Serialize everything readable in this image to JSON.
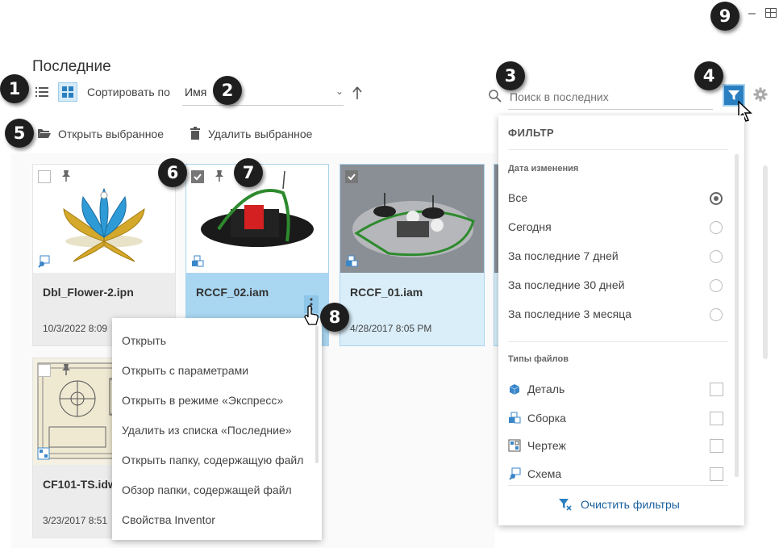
{
  "window": {
    "minimize_glyph": "–",
    "restore_glyph": "⊞"
  },
  "header": {
    "title": "Последние"
  },
  "toolbar": {
    "sort_label": "Сортировать по",
    "sort_value": "Имя",
    "search_placeholder": "Поиск в последних",
    "open_selected": "Открыть выбранное",
    "delete_selected": "Удалить выбранное"
  },
  "files": [
    {
      "name": "Dbl_Flower-2.ipn",
      "date": "10/3/2022 8:09"
    },
    {
      "name": "RCCF_02.iam",
      "date": ""
    },
    {
      "name": "RCCF_01.iam",
      "date": "4/28/2017 8:05 PM"
    },
    {
      "name": "CF101-TS.idw",
      "date": "3/23/2017 8:51"
    }
  ],
  "context_menu": [
    "Открыть",
    "Открыть с параметрами",
    "Открыть в режиме «Экспресс»",
    "Удалить из списка «Последние»",
    "Открыть папку, содержащую файл",
    "Обзор папки, содержащей файл",
    "Свойства Inventor"
  ],
  "filter": {
    "title": "ФИЛЬТР",
    "date_section": "Дата изменения",
    "date_options": [
      "Все",
      "Сегодня",
      "За последние 7 дней",
      "За последние 30 дней",
      "За последние 3 месяца"
    ],
    "selected_date": "Все",
    "types_section": "Типы файлов",
    "types": [
      "Деталь",
      "Сборка",
      "Чертеж",
      "Схема"
    ],
    "clear": "Очистить фильтры"
  },
  "callouts": [
    "1",
    "2",
    "3",
    "4",
    "5",
    "6",
    "7",
    "8",
    "9"
  ],
  "colors": {
    "accent": "#2a7fc0",
    "selected_card": "#d9eef9",
    "active_card": "#a9d6f1"
  }
}
